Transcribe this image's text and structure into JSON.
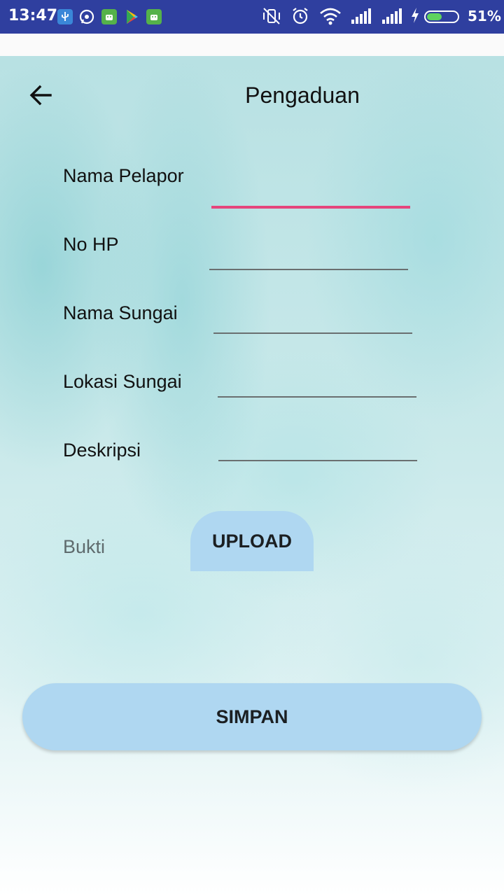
{
  "status_bar": {
    "time": "13:47",
    "battery": "51%",
    "battery_level": 0.51,
    "notification_icons": [
      "usb-icon",
      "whatsapp-icon",
      "android-icon",
      "play-store-icon",
      "android-icon"
    ],
    "system_icons": [
      "vibrate-off-icon",
      "alarm-icon",
      "wifi-icon",
      "signal-icon",
      "signal-icon",
      "charging-icon",
      "battery-icon"
    ]
  },
  "header": {
    "title": "Pengaduan"
  },
  "form": {
    "nama_pelapor": {
      "label": "Nama Pelapor",
      "value": ""
    },
    "no_hp": {
      "label": "No HP",
      "value": ""
    },
    "nama_sungai": {
      "label": "Nama Sungai",
      "value": ""
    },
    "lokasi_sungai": {
      "label": "Lokasi Sungai",
      "value": ""
    },
    "deskripsi": {
      "label": "Deskripsi",
      "value": ""
    },
    "bukti": {
      "label": "Bukti",
      "button": "UPLOAD"
    }
  },
  "actions": {
    "save_label": "SIMPAN"
  },
  "colors": {
    "status_bar": "#2f3f9f",
    "accent_focus": "#e5457c",
    "button": "#afd7f1"
  }
}
